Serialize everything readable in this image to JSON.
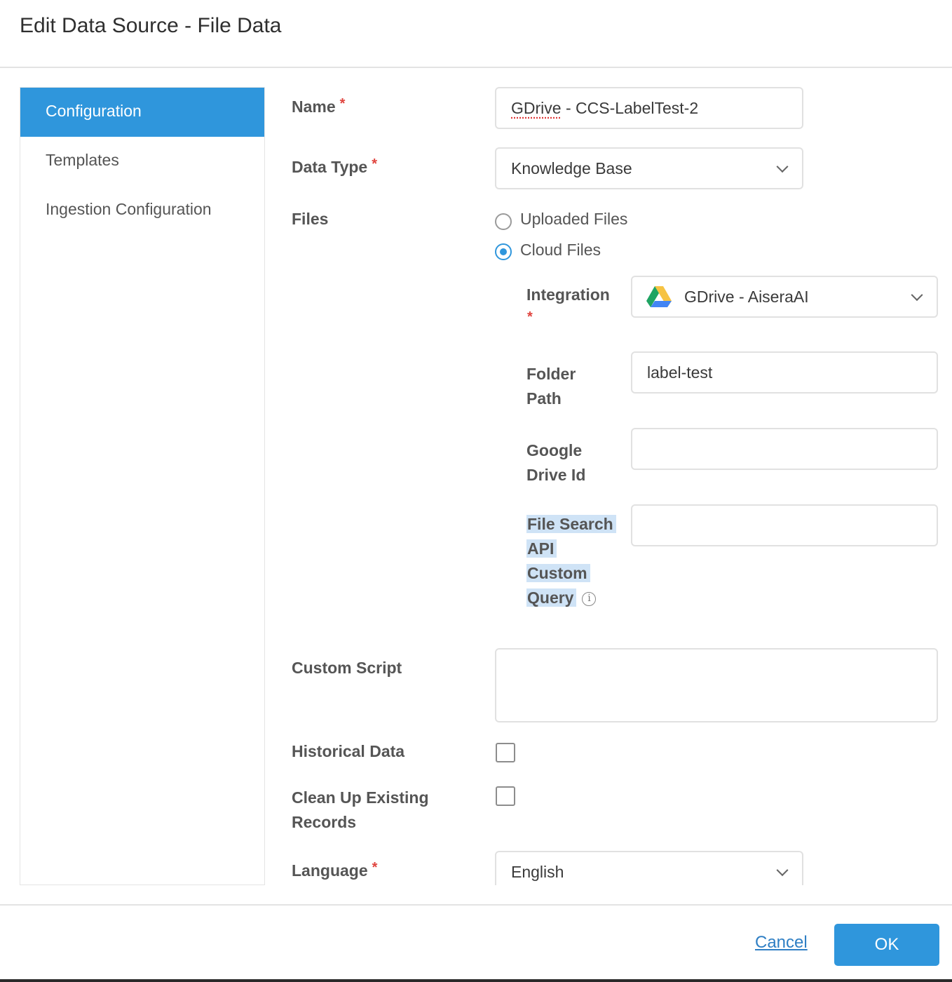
{
  "dialog": {
    "title": "Edit Data Source - File Data"
  },
  "sidebar": {
    "items": [
      {
        "label": "Configuration",
        "active": true
      },
      {
        "label": "Templates",
        "active": false
      },
      {
        "label": "Ingestion Configuration",
        "active": false
      }
    ]
  },
  "form": {
    "required_mark": "*",
    "name": {
      "label": "Name",
      "value": "GDrive - CCS-LabelTest-2",
      "value_underlined": "GDrive",
      "value_rest": " - CCS-LabelTest-2"
    },
    "data_type": {
      "label": "Data Type",
      "value": "Knowledge Base"
    },
    "files": {
      "label": "Files",
      "options": [
        {
          "label": "Uploaded Files",
          "checked": false
        },
        {
          "label": "Cloud Files",
          "checked": true
        }
      ]
    },
    "integration": {
      "label": "Integration",
      "value": "GDrive - AiseraAI",
      "icon": "google-drive-icon"
    },
    "folder_path": {
      "label_line1": "Folder",
      "label_line2": "Path",
      "value": "label-test"
    },
    "google_drive_id": {
      "label_line1": "Google",
      "label_line2": "Drive Id",
      "value": ""
    },
    "file_search_query": {
      "label_lines": [
        "File Search",
        "API",
        "Custom",
        "Query"
      ],
      "info_glyph": "i",
      "value": ""
    },
    "custom_script": {
      "label": "Custom Script",
      "value": ""
    },
    "historical_data": {
      "label": "Historical Data",
      "checked": false
    },
    "clean_up": {
      "label_line1": "Clean Up Existing",
      "label_line2": "Records",
      "checked": false
    },
    "language": {
      "label": "Language",
      "value": "English"
    }
  },
  "footer": {
    "cancel_label": "Cancel",
    "ok_label": "OK"
  },
  "colors": {
    "accent": "#2f96dc",
    "required": "#e0443e",
    "selection_highlight": "#cfe3f6"
  }
}
